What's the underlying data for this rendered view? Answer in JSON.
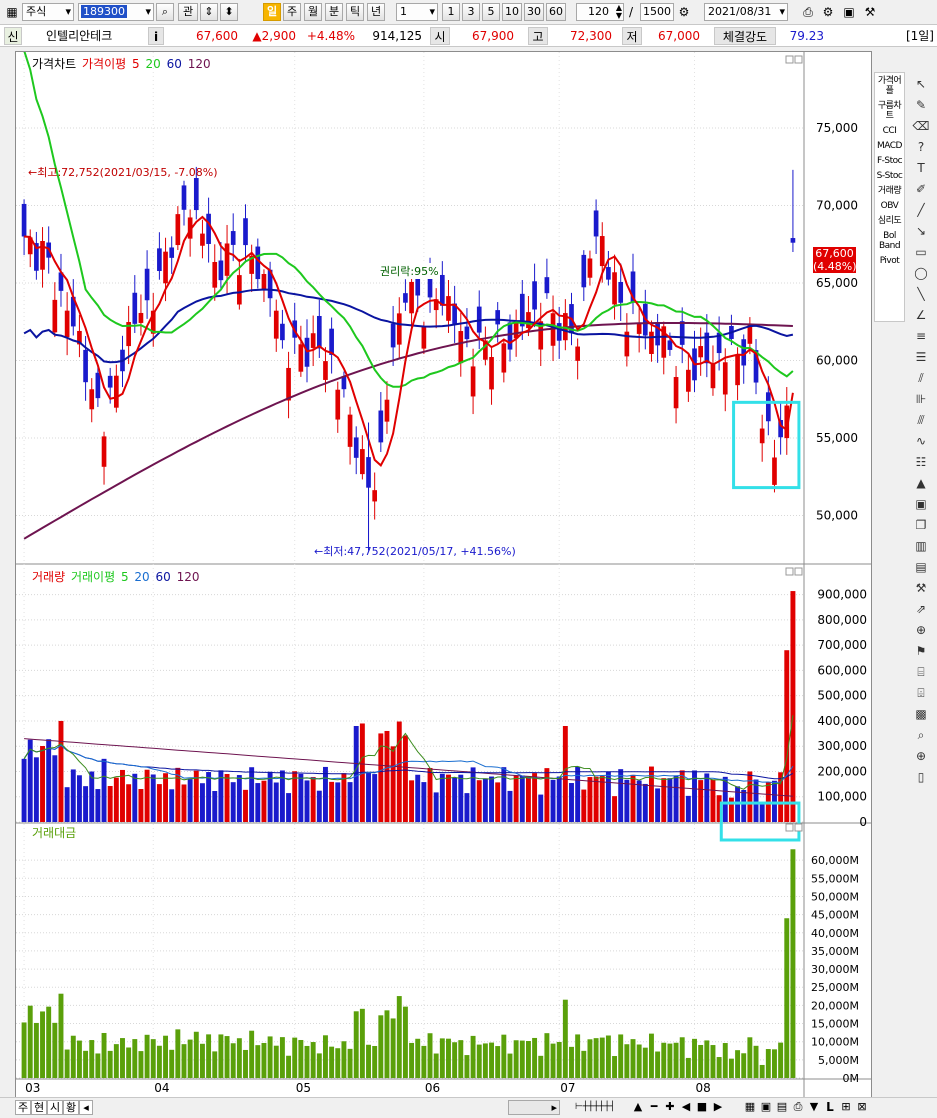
{
  "toolbar": {
    "market": "주식",
    "code": "189300",
    "btn_gwan": "관",
    "period_tabs": [
      "일",
      "주",
      "월",
      "분",
      "틱",
      "년"
    ],
    "active_period": "일",
    "interval_value": "1",
    "quick_intervals": [
      "1",
      "3",
      "5",
      "10",
      "30",
      "60"
    ],
    "count": "120",
    "slash": "/",
    "total": "1500",
    "date": "2021/08/31"
  },
  "info": {
    "market_badge": "신",
    "name": "인텔리안테크",
    "info_icon": "i",
    "price": "67,600",
    "change": "▲2,900",
    "change_pct": "+4.48%",
    "volume": "914,125",
    "open_label": "시",
    "open": "67,900",
    "high_label": "고",
    "high": "72,300",
    "low_label": "저",
    "low": "67,000",
    "strength_label": "체결강도",
    "strength": "79.23",
    "period_badge": "[1일]"
  },
  "legends": {
    "price": [
      "가격차트",
      "가격이평",
      "5",
      "20",
      "60",
      "120"
    ],
    "volume": [
      "거래량",
      "거래이평",
      "5",
      "20",
      "60",
      "120"
    ],
    "amount": [
      "거래대금"
    ]
  },
  "annotations": {
    "max": "←최고:72,752(2021/03/15, -7.08%)",
    "min": "←최저:47,752(2021/05/17, +41.56%)",
    "rights": "권리락:95%",
    "last_price": "67,600",
    "last_pct": "(4.48%)"
  },
  "right_panel": [
    "가격어플",
    "구름차트",
    "CCI",
    "MACD",
    "F-Stoc",
    "S-Stoc",
    "거래량",
    "OBV",
    "심리도",
    "Bol Band",
    "Pivot"
  ],
  "bottom": {
    "tabs": [
      "주",
      "현",
      "시",
      "황"
    ]
  },
  "colors": {
    "up": "#e00000",
    "down": "#1a1acc",
    "ma5": "#e00000",
    "ma20": "#1ec81e",
    "ma60": "#0a14a0",
    "ma120": "#6e1450",
    "highlight": "#33e0e8",
    "amount": "#5aa00a"
  },
  "chart_data": [
    {
      "type": "candlestick",
      "title": "가격차트",
      "x_ticks": [
        "03",
        "04",
        "05",
        "06",
        "07",
        "08"
      ],
      "ylim": [
        47000,
        79000
      ],
      "y_ticks": [
        "50,000",
        "55,000",
        "60,000",
        "65,000",
        "70,000",
        "75,000"
      ],
      "series_ohlc_approx": [
        [
          67900,
          72300,
          67000,
          67600
        ]
      ],
      "moving_averages": [
        "5",
        "20",
        "60",
        "120"
      ]
    },
    {
      "type": "bar",
      "title": "거래량",
      "ylim": [
        0,
        950000
      ],
      "y_ticks": [
        "0",
        "100,000",
        "200,000",
        "300,000",
        "400,000",
        "500,000",
        "600,000",
        "700,000",
        "800,000",
        "900,000"
      ],
      "last_values": [
        680000,
        914125
      ]
    },
    {
      "type": "bar",
      "title": "거래대금",
      "ylim": [
        0,
        65000
      ],
      "y_ticks": [
        "0M",
        "5,000M",
        "10,000M",
        "15,000M",
        "20,000M",
        "25,000M",
        "30,000M",
        "35,000M",
        "40,000M",
        "45,000M",
        "50,000M",
        "55,000M",
        "60,000M"
      ],
      "last_values": [
        44000,
        63000
      ]
    }
  ]
}
